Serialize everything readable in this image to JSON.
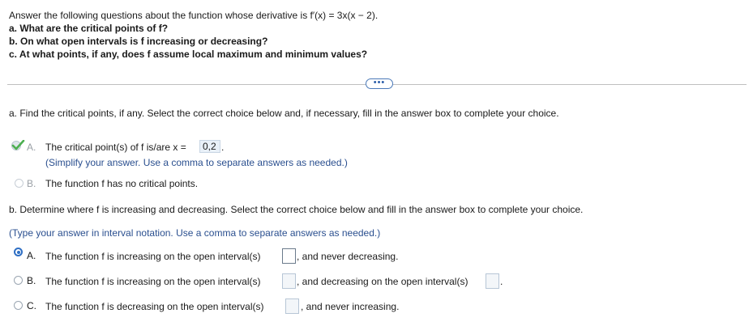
{
  "question": {
    "intro": "Answer the following questions about the function whose derivative is f′(x) = 3x(x − 2).",
    "part_a": "a. What are the critical points of f?",
    "part_b": "b. On what open intervals is f increasing or decreasing?",
    "part_c": "c. At what points, if any, does f assume local maximum and minimum values?"
  },
  "more_button": "•••",
  "section_a": {
    "prompt": "a. Find the critical points, if any. Select the correct choice below and, if necessary, fill in the answer box to complete your choice.",
    "option_a": {
      "letter": "A.",
      "text_before": "The critical point(s) of f is/are x =",
      "answer": "0,2",
      "text_after": ".",
      "hint": "(Simplify your answer. Use a comma to separate answers as needed.)"
    },
    "option_b": {
      "letter": "B.",
      "text": "The function f has no critical points."
    }
  },
  "section_b": {
    "prompt": "b. Determine where f is increasing and decreasing. Select the correct choice below and fill in the answer box to complete your choice.",
    "hint": "(Type your answer in interval notation. Use a comma to separate answers as needed.)",
    "option_a": {
      "letter": "A.",
      "text_before": "The function f is increasing on the open interval(s)",
      "text_after": ", and never decreasing."
    },
    "option_b": {
      "letter": "B.",
      "text_before": "The function f is increasing on the open interval(s)",
      "text_middle": ", and decreasing on the open interval(s)",
      "text_after": "."
    },
    "option_c": {
      "letter": "C.",
      "text_before": "The function f is decreasing on the open interval(s)",
      "text_after": ", and never increasing."
    }
  },
  "colors": {
    "accent": "#2f6fc4",
    "hint_text": "#2a4f8f",
    "check_green": "#4caf50"
  }
}
